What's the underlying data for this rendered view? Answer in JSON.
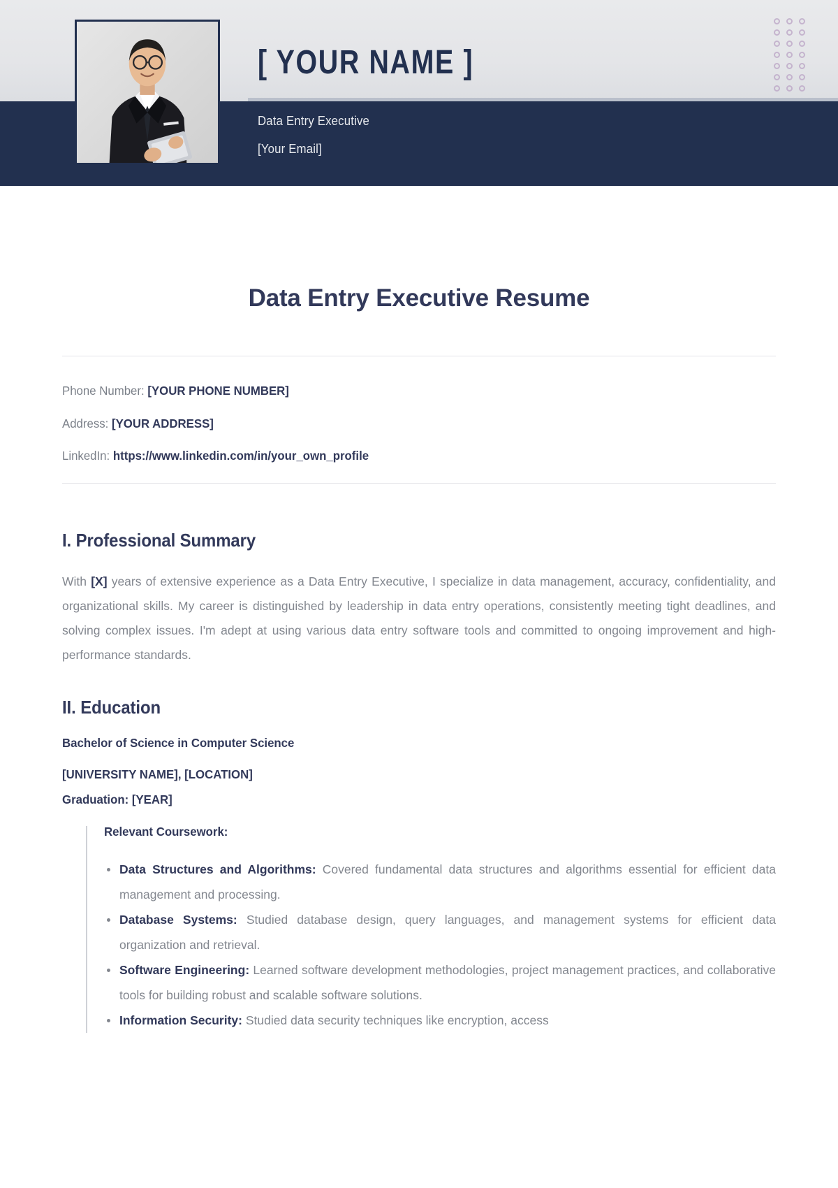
{
  "header": {
    "name": "[ YOUR NAME ]",
    "role": "Data Entry Executive",
    "email": "[Your Email]",
    "photo_alt": "headshot-photo",
    "accent_navy": "#22304f",
    "dot_color": "#b9a3c4",
    "dot_rows": 7,
    "dot_cols": 3
  },
  "document": {
    "title": "Data Entry Executive Resume"
  },
  "contact": {
    "phone_label": "Phone Number:",
    "phone_value": "[YOUR PHONE NUMBER]",
    "address_label": "Address:",
    "address_value": "[YOUR ADDRESS]",
    "linkedin_label": "LinkedIn:",
    "linkedin_value": "https://www.linkedin.com/in/your_own_profile"
  },
  "summary": {
    "heading": "I. Professional Summary",
    "lead_prefix": "With ",
    "lead_bold": "[X]",
    "body": " years of extensive experience as a Data Entry Executive, I specialize in data management, accuracy, confidentiality, and organizational skills. My career is distinguished by leadership in data entry operations, consistently meeting tight deadlines, and solving complex issues. I'm adept at using various data entry software tools and committed to ongoing improvement and high-performance standards."
  },
  "education": {
    "heading": "II. Education",
    "degree": "Bachelor of Science in Computer Science",
    "university": "[UNIVERSITY NAME], [LOCATION]",
    "graduation": "Graduation: [YEAR]",
    "coursework_label": "Relevant Coursework:",
    "courses": [
      {
        "name": "Data Structures and Algorithms:",
        "description": " Covered fundamental data structures and algorithms essential for efficient data management and processing."
      },
      {
        "name": "Database Systems:",
        "description": " Studied database design, query languages, and management systems for efficient data organization and retrieval."
      },
      {
        "name": "Software Engineering:",
        "description": " Learned software development methodologies, project management practices, and collaborative tools for building robust and scalable software solutions."
      },
      {
        "name": "Information Security:",
        "description": " Studied data security techniques like encryption, access"
      }
    ]
  }
}
